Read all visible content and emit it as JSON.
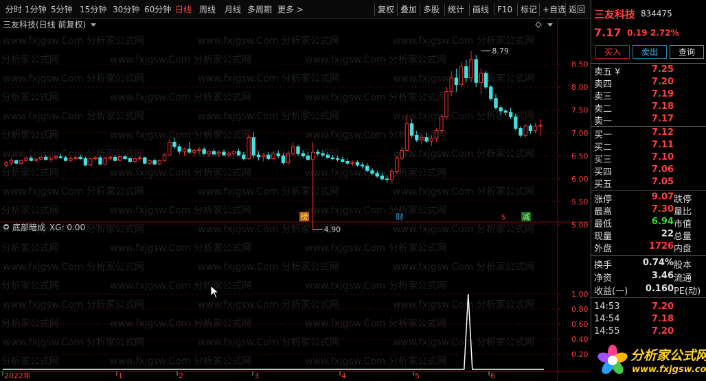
{
  "toolbar": {
    "periods": [
      "分时",
      "1分钟",
      "5分钟",
      "15分钟",
      "30分钟",
      "60分钟",
      "日线",
      "周线",
      "月线",
      "多周期",
      "更多 >"
    ],
    "active_period": "日线",
    "tools": [
      "复权",
      "叠加",
      "多股",
      "统计",
      "画线",
      "F10",
      "标记",
      "+自选",
      "返回"
    ]
  },
  "chart_header": {
    "title": "三友科技(日线 前复权)"
  },
  "indicator_header": {
    "title": "底部暗成",
    "value": "XG: 0.00"
  },
  "watermark": {
    "text": "www.fxjgsw.Com 分析家公式网"
  },
  "x_axis": {
    "labels": [
      "2022年",
      "1",
      "2",
      "3",
      "4",
      "5",
      "6"
    ]
  },
  "price_axis": {
    "ticks": [
      "8.50",
      "8.00",
      "7.50",
      "7.00",
      "6.50",
      "6.00",
      "5.50",
      "5.00"
    ]
  },
  "indicator_axis": {
    "ticks": [
      "1.00",
      "0.80",
      "0.60",
      "0.40",
      "0.20"
    ]
  },
  "annotations": {
    "high": "8.79",
    "low": "4.90"
  },
  "event_markers": [
    "榜",
    "财",
    "$",
    "减"
  ],
  "stock": {
    "name": "三友科技",
    "code": "834475",
    "price": "7.17",
    "change": "0.19",
    "pct": "2.72%"
  },
  "actions": {
    "buy": "买入",
    "sell": "卖出",
    "query": "查询"
  },
  "order_book": {
    "asks": [
      {
        "label": "卖五 ¥",
        "price": "7.25"
      },
      {
        "label": "卖四",
        "price": "7.20"
      },
      {
        "label": "卖三",
        "price": "7.19"
      },
      {
        "label": "卖二",
        "price": "7.18"
      },
      {
        "label": "卖一",
        "price": "7.17"
      }
    ],
    "bids": [
      {
        "label": "买一",
        "price": "7.12"
      },
      {
        "label": "买二",
        "price": "7.11"
      },
      {
        "label": "买三",
        "price": "7.10"
      },
      {
        "label": "买四",
        "price": "7.06"
      },
      {
        "label": "买五",
        "price": "7.05"
      }
    ]
  },
  "stats": [
    {
      "l1": "涨停",
      "v1": "9.07",
      "c1": "#ff4040",
      "l2": "跌停"
    },
    {
      "l1": "最高",
      "v1": "7.30",
      "c1": "#ff4040",
      "l2": "量比"
    },
    {
      "l1": "最低",
      "v1": "6.94",
      "c1": "#3fd43f",
      "l2": "市值"
    },
    {
      "l1": "现量",
      "v1": "22",
      "c1": "#e0e0e0",
      "l2": "总量"
    },
    {
      "l1": "外盘",
      "v1": "1726",
      "c1": "#ff4040",
      "l2": "内盘"
    }
  ],
  "stats2": [
    {
      "l1": "换手",
      "v1": "0.74%",
      "l2": "股本"
    },
    {
      "l1": "净资",
      "v1": "3.46",
      "l2": "流通"
    },
    {
      "l1": "收益(一)",
      "v1": "0.160",
      "l2": "PE(动)"
    }
  ],
  "ticks": [
    {
      "time": "14:53",
      "price": "7.20"
    },
    {
      "time": "14:54",
      "price": "7.18"
    },
    {
      "time": "14:55",
      "price": "7.20"
    }
  ],
  "logo": {
    "name": "分析家公式网",
    "url": "www.fxjgsw.com"
  },
  "colors": {
    "up": "#ff3030",
    "down": "#44e0e0",
    "grid": "#7a1010",
    "accent": "#ff4040"
  },
  "chart_data": {
    "type": "candlestick",
    "price_range": [
      4.8,
      8.9
    ],
    "indicator_range": [
      0,
      1.1
    ],
    "candles": [
      [
        6.3,
        6.38,
        6.25,
        6.35
      ],
      [
        6.35,
        6.45,
        6.3,
        6.4
      ],
      [
        6.4,
        6.42,
        6.32,
        6.34
      ],
      [
        6.34,
        6.42,
        6.3,
        6.4
      ],
      [
        6.4,
        6.48,
        6.38,
        6.45
      ],
      [
        6.45,
        6.5,
        6.38,
        6.4
      ],
      [
        6.4,
        6.46,
        6.35,
        6.43
      ],
      [
        6.43,
        6.5,
        6.4,
        6.47
      ],
      [
        6.47,
        6.52,
        6.4,
        6.42
      ],
      [
        6.42,
        6.48,
        6.36,
        6.45
      ],
      [
        6.45,
        6.52,
        6.42,
        6.48
      ],
      [
        6.48,
        6.55,
        6.44,
        6.46
      ],
      [
        6.46,
        6.5,
        6.38,
        6.4
      ],
      [
        6.4,
        6.48,
        6.36,
        6.44
      ],
      [
        6.44,
        6.5,
        6.4,
        6.47
      ],
      [
        6.47,
        6.52,
        6.42,
        6.44
      ],
      [
        6.44,
        6.48,
        6.28,
        6.3
      ],
      [
        6.3,
        6.46,
        6.28,
        6.44
      ],
      [
        6.44,
        6.5,
        6.4,
        6.46
      ],
      [
        6.46,
        6.5,
        6.3,
        6.32
      ],
      [
        6.32,
        6.48,
        6.3,
        6.45
      ],
      [
        6.45,
        6.5,
        6.4,
        6.47
      ],
      [
        6.47,
        6.52,
        6.38,
        6.4
      ],
      [
        6.4,
        6.5,
        6.38,
        6.48
      ],
      [
        6.48,
        6.52,
        6.42,
        6.44
      ],
      [
        6.44,
        6.48,
        6.35,
        6.38
      ],
      [
        6.38,
        6.46,
        6.34,
        6.44
      ],
      [
        6.44,
        6.5,
        6.4,
        6.46
      ],
      [
        6.46,
        6.48,
        6.32,
        6.34
      ],
      [
        6.34,
        6.42,
        6.3,
        6.4
      ],
      [
        6.4,
        6.44,
        6.3,
        6.32
      ],
      [
        6.32,
        6.42,
        6.3,
        6.4
      ],
      [
        6.4,
        6.56,
        6.38,
        6.52
      ],
      [
        6.52,
        6.85,
        6.5,
        6.8
      ],
      [
        6.8,
        6.9,
        6.65,
        6.7
      ],
      [
        6.7,
        6.75,
        6.55,
        6.6
      ],
      [
        6.6,
        6.68,
        6.5,
        6.65
      ],
      [
        6.65,
        6.8,
        6.55,
        6.58
      ],
      [
        6.58,
        6.66,
        6.5,
        6.62
      ],
      [
        6.62,
        6.7,
        6.55,
        6.64
      ],
      [
        6.64,
        6.7,
        6.52,
        6.55
      ],
      [
        6.55,
        6.62,
        6.48,
        6.6
      ],
      [
        6.6,
        6.66,
        6.5,
        6.54
      ],
      [
        6.54,
        6.62,
        6.48,
        6.58
      ],
      [
        6.58,
        6.64,
        6.5,
        6.52
      ],
      [
        6.52,
        6.6,
        6.46,
        6.56
      ],
      [
        6.56,
        6.62,
        6.5,
        6.6
      ],
      [
        6.6,
        6.66,
        6.5,
        6.52
      ],
      [
        6.52,
        6.58,
        6.4,
        6.44
      ],
      [
        6.44,
        6.96,
        6.42,
        6.9
      ],
      [
        6.9,
        7.02,
        6.45,
        6.52
      ],
      [
        6.52,
        6.6,
        6.4,
        6.48
      ],
      [
        6.48,
        6.56,
        6.38,
        6.52
      ],
      [
        6.52,
        6.58,
        6.4,
        6.44
      ],
      [
        6.44,
        6.6,
        6.4,
        6.55
      ],
      [
        6.55,
        6.62,
        6.45,
        6.5
      ],
      [
        6.5,
        6.56,
        6.3,
        6.35
      ],
      [
        6.35,
        6.6,
        6.3,
        6.55
      ],
      [
        6.55,
        6.8,
        6.5,
        6.7
      ],
      [
        6.7,
        6.74,
        6.5,
        6.55
      ],
      [
        6.55,
        6.62,
        6.45,
        6.5
      ],
      [
        6.5,
        6.58,
        6.4,
        6.42
      ],
      [
        6.42,
        6.8,
        4.9,
        6.58
      ],
      [
        6.58,
        6.64,
        6.5,
        6.55
      ],
      [
        6.55,
        6.62,
        6.48,
        6.52
      ],
      [
        6.52,
        6.58,
        6.44,
        6.46
      ],
      [
        6.46,
        6.52,
        6.4,
        6.44
      ],
      [
        6.44,
        6.5,
        6.38,
        6.42
      ],
      [
        6.42,
        6.48,
        6.35,
        6.38
      ],
      [
        6.38,
        6.44,
        6.3,
        6.34
      ],
      [
        6.34,
        6.4,
        6.28,
        6.36
      ],
      [
        6.36,
        6.4,
        6.26,
        6.3
      ],
      [
        6.3,
        6.36,
        6.22,
        6.28
      ],
      [
        6.28,
        6.34,
        6.15,
        6.18
      ],
      [
        6.18,
        6.24,
        6.08,
        6.12
      ],
      [
        6.12,
        6.18,
        6.02,
        6.06
      ],
      [
        6.06,
        6.14,
        5.96,
        6.0
      ],
      [
        6.0,
        6.08,
        5.92,
        5.98
      ],
      [
        5.98,
        6.2,
        5.9,
        6.16
      ],
      [
        6.16,
        6.5,
        6.1,
        6.45
      ],
      [
        6.45,
        6.7,
        6.4,
        6.62
      ],
      [
        6.62,
        7.38,
        6.6,
        7.2
      ],
      [
        7.2,
        7.3,
        6.9,
        6.95
      ],
      [
        6.95,
        7.05,
        6.8,
        6.85
      ],
      [
        6.85,
        6.98,
        6.75,
        6.9
      ],
      [
        6.9,
        7.0,
        6.78,
        6.82
      ],
      [
        6.82,
        6.95,
        6.72,
        6.88
      ],
      [
        6.88,
        7.1,
        6.8,
        7.05
      ],
      [
        7.05,
        7.4,
        7.0,
        7.35
      ],
      [
        7.35,
        8.0,
        7.3,
        7.9
      ],
      [
        7.9,
        8.35,
        7.8,
        8.2
      ],
      [
        8.2,
        8.4,
        7.9,
        8.05
      ],
      [
        8.05,
        8.55,
        8.0,
        8.45
      ],
      [
        8.45,
        8.6,
        8.1,
        8.2
      ],
      [
        8.2,
        8.79,
        8.1,
        8.6
      ],
      [
        8.6,
        8.7,
        8.0,
        8.1
      ],
      [
        8.1,
        8.4,
        7.85,
        8.3
      ],
      [
        8.3,
        8.35,
        7.95,
        8.0
      ],
      [
        8.0,
        8.05,
        7.7,
        7.75
      ],
      [
        7.75,
        7.85,
        7.5,
        7.55
      ],
      [
        7.55,
        7.6,
        7.4,
        7.48
      ],
      [
        7.48,
        7.52,
        7.38,
        7.45
      ],
      [
        7.45,
        7.55,
        7.3,
        7.35
      ],
      [
        7.35,
        7.42,
        7.05,
        7.1
      ],
      [
        7.1,
        7.15,
        6.9,
        6.95
      ],
      [
        6.95,
        7.2,
        6.9,
        7.15
      ],
      [
        7.15,
        7.2,
        6.98,
        7.05
      ],
      [
        7.05,
        7.22,
        7.0,
        7.15
      ],
      [
        7.15,
        7.3,
        6.94,
        7.17
      ]
    ],
    "indicator_signal": {
      "index": 94,
      "value": 1.0
    }
  }
}
